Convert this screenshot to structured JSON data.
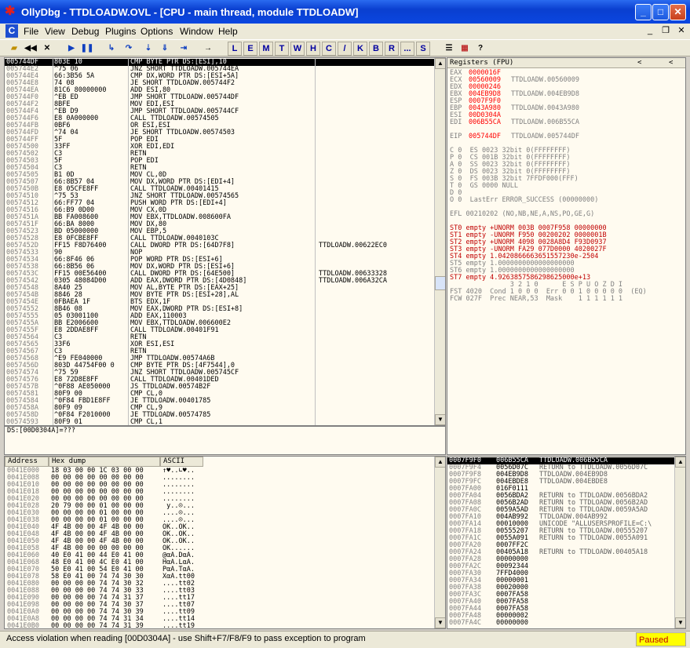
{
  "window": {
    "title": "OllyDbg - TTDLOADW.OVL - [CPU - main thread, module TTDLOADW]",
    "min": "_",
    "max": "□",
    "close": "✕"
  },
  "menu": [
    "File",
    "View",
    "Debug",
    "Plugins",
    "Options",
    "Window",
    "Help"
  ],
  "toolbar_letters": [
    "L",
    "E",
    "M",
    "T",
    "W",
    "H",
    "C",
    "/",
    "K",
    "B",
    "R",
    "...",
    "S"
  ],
  "disasm": [
    [
      "005744DF",
      "803E 10",
      "CMP BYTE PTR DS:[ESI],10",
      ""
    ],
    [
      "005744E2",
      "^75 06",
      "JNZ SHORT TTDLOADW.005744EA",
      ""
    ],
    [
      "005744E4",
      "66:3B56 5A",
      "CMP DX,WORD PTR DS:[ESI+5A]",
      ""
    ],
    [
      "005744E8",
      "74 08",
      "JE SHORT TTDLOADW.005744F2",
      ""
    ],
    [
      "005744EA",
      "81C6 80000000",
      "ADD ESI,80",
      ""
    ],
    [
      "005744F0",
      "^EB ED",
      "JMP SHORT TTDLOADW.005744DF",
      ""
    ],
    [
      "005744F2",
      "8BFE",
      "MOV EDI,ESI",
      ""
    ],
    [
      "005744F4",
      "^EB D9",
      "JMP SHORT TTDLOADW.005744CF",
      ""
    ],
    [
      "005744F6",
      "E8 0A000000",
      "CALL TTDLOADW.00574505",
      ""
    ],
    [
      "005744FB",
      "0BF6",
      "OR ESI,ESI",
      ""
    ],
    [
      "005744FD",
      "^74 04",
      "JE SHORT TTDLOADW.00574503",
      ""
    ],
    [
      "005744FF",
      "5F",
      "POP EDI",
      ""
    ],
    [
      "00574500",
      "33FF",
      "XOR EDI,EDI",
      ""
    ],
    [
      "00574502",
      "C3",
      "RETN",
      ""
    ],
    [
      "00574503",
      "5F",
      "POP EDI",
      ""
    ],
    [
      "00574504",
      "C3",
      "RETN",
      ""
    ],
    [
      "00574505",
      "B1 0D",
      "MOV CL,0D",
      ""
    ],
    [
      "00574507",
      "66:8B57 04",
      "MOV DX,WORD PTR DS:[EDI+4]",
      ""
    ],
    [
      "0057450B",
      "E8 05CFE8FF",
      "CALL TTDLOADW.00401415",
      ""
    ],
    [
      "00574510",
      "^75 53",
      "JNZ SHORT TTDLOADW.00574565",
      ""
    ],
    [
      "00574512",
      "66:FF77 04",
      "PUSH WORD PTR DS:[EDI+4]",
      ""
    ],
    [
      "00574516",
      "66:B9 0D00",
      "MOV CX,0D",
      ""
    ],
    [
      "0057451A",
      "BB FA008600",
      "MOV EBX,TTDLOADW.008600FA",
      ""
    ],
    [
      "0057451F",
      "66:BA 8000",
      "MOV DX,80",
      ""
    ],
    [
      "00574523",
      "BD 05000000",
      "MOV EBP,5",
      ""
    ],
    [
      "00574528",
      "E8 0FCBE8FF",
      "CALL TTDLOADW.0040103C",
      ""
    ],
    [
      "0057452D",
      "FF15 F8D76400",
      "CALL DWORD PTR DS:[64D7F8]",
      "TTDLOADW.00622EC0"
    ],
    [
      "00574533",
      "90",
      "NOP",
      ""
    ],
    [
      "00574534",
      "66:8F46 06",
      "POP WORD PTR DS:[ESI+6]",
      ""
    ],
    [
      "00574538",
      "66:8B56 06",
      "MOV DX,WORD PTR DS:[ESI+6]",
      ""
    ],
    [
      "0057453C",
      "FF15 00E56400",
      "CALL DWORD PTR DS:[64E500]",
      "TTDLOADW.00633328"
    ],
    [
      "00574542",
      "0305 48084D00",
      "ADD EAX,DWORD PTR DS:[4D0848]",
      "TTDLOADW.006A32CA"
    ],
    [
      "00574548",
      "8A40 25",
      "MOV AL,BYTE PTR DS:[EAX+25]",
      ""
    ],
    [
      "0057454B",
      "8846 28",
      "MOV BYTE PTR DS:[ESI+28],AL",
      ""
    ],
    [
      "0057454E",
      "0FBAEA 1F",
      "BTS EDX,1F",
      ""
    ],
    [
      "00574552",
      "8B46 08",
      "MOV EAX,DWORD PTR DS:[ESI+8]",
      ""
    ],
    [
      "00574555",
      "05 03001100",
      "ADD EAX,110003",
      ""
    ],
    [
      "0057455A",
      "BB E2006600",
      "MOV EBX,TTDLOADW.006600E2",
      ""
    ],
    [
      "0057455F",
      "E8 2DDAE8FF",
      "CALL TTDLOADW.00401F91",
      ""
    ],
    [
      "00574564",
      "C3",
      "RETN",
      ""
    ],
    [
      "00574565",
      "33F6",
      "XOR ESI,ESI",
      ""
    ],
    [
      "00574567",
      "C3",
      "RETN",
      ""
    ],
    [
      "00574568",
      "^E9 FE040000",
      "JMP TTDLOADW.00574A6B",
      ""
    ],
    [
      "0057456D",
      "803D 44754F00 0",
      "CMP BYTE PTR DS:[4F7544],0",
      ""
    ],
    [
      "00574574",
      "^75 59",
      "JNZ SHORT TTDLOADW.005745CF",
      ""
    ],
    [
      "00574576",
      "E8 72D8E8FF",
      "CALL TTDLOADW.00401DED",
      ""
    ],
    [
      "0057457B",
      "^0F88 AE050000",
      "JS TTDLOADW.00574B2F",
      ""
    ],
    [
      "00574581",
      "80F9 00",
      "CMP CL,0",
      ""
    ],
    [
      "00574584",
      "^0F84 FBD1E8FF",
      "JE TTDLOADW.00401785",
      ""
    ],
    [
      "0057458A",
      "80F9 09",
      "CMP CL,9",
      ""
    ],
    [
      "0057458D",
      "^0F84 F2010000",
      "JE TTDLOADW.00574785",
      ""
    ],
    [
      "00574593",
      "80F9 01",
      "CMP CL,1",
      ""
    ]
  ],
  "info_line": "DS:[00D0304A]=???",
  "registers": {
    "header": "Registers (FPU)",
    "lines": [
      [
        "EAX",
        "0000016F",
        ""
      ],
      [
        "ECX",
        "00560009",
        "TTDLOADW.00560009"
      ],
      [
        "EDX",
        "00000246",
        ""
      ],
      [
        "EBX",
        "004EB9D8",
        "TTDLOADW.004EB9D8"
      ],
      [
        "ESP",
        "0007F9F0",
        ""
      ],
      [
        "EBP",
        "0043A980",
        "TTDLOADW.0043A980"
      ],
      [
        "ESI",
        "00D0304A",
        ""
      ],
      [
        "EDI",
        "006B55CA",
        "TTDLOADW.006B55CA"
      ],
      [
        "",
        "",
        " "
      ],
      [
        "EIP",
        "005744DF",
        "TTDLOADW.005744DF"
      ]
    ],
    "flags": [
      "C 0  ES 0023 32bit 0(FFFFFFFF)",
      "P 0  CS 001B 32bit 0(FFFFFFFF)",
      "A 0  SS 0023 32bit 0(FFFFFFFF)",
      "Z 0  DS 0023 32bit 0(FFFFFFFF)",
      "S 0  FS 003B 32bit 7FFDF000(FFF)",
      "T 0  GS 0000 NULL",
      "D 0",
      "O 0  LastErr ERROR_SUCCESS (00000000)"
    ],
    "efl": "EFL 00210202 (NO,NB,NE,A,NS,PO,GE,G)",
    "fpu": [
      "ST0 empty +UNORM 003B 0007F958 00000000",
      "ST1 empty -UNORM F950 00200202 0000001B",
      "ST2 empty +UNORM 4098 0028A8D4 F93D0937",
      "ST3 empty -UNORM FA29 077D0000 4020027F",
      "ST4 empty 1.0420866663651557230e-2504",
      "ST5 empty 1.0000000000000000000",
      "ST6 empty 1.0000000000000000000",
      "ST7 empty 4.9263857586298625000e+13"
    ],
    "fst_head": "               3 2 1 0      E S P U O Z D I",
    "fst": "FST 4020  Cond 1 0 0 0  Err 0 0 1 0 0 0 0 0  (EQ)",
    "fcw": "FCW 027F  Prec NEAR,53  Mask    1 1 1 1 1 1"
  },
  "dump": {
    "headers": [
      "Address",
      "Hex dump",
      "ASCII"
    ],
    "rows": [
      [
        "0041E000",
        "18 03 00 00 1C 03 00 00",
        "↑♥..∟♥.."
      ],
      [
        "0041E008",
        "00 00 00 00 00 00 00 00",
        "........"
      ],
      [
        "0041E010",
        "00 00 00 00 00 00 00 00",
        "........"
      ],
      [
        "0041E018",
        "00 00 00 00 00 00 00 00",
        "........"
      ],
      [
        "0041E020",
        "00 00 00 00 00 00 00 00",
        "........"
      ],
      [
        "0041E028",
        "20 79 00 00 01 00 00 00",
        " y..☺..."
      ],
      [
        "0041E030",
        "00 00 00 00 01 00 00 00",
        "....☺..."
      ],
      [
        "0041E038",
        "00 00 00 00 01 00 00 00",
        "....☺..."
      ],
      [
        "0041E040",
        "4F 4B 00 00 4F 4B 00 00",
        "OK..OK.."
      ],
      [
        "0041E048",
        "4F 4B 00 00 4F 4B 00 00",
        "OK..OK.."
      ],
      [
        "0041E050",
        "4F 4B 00 00 4F 4B 00 00",
        "OK..OK.."
      ],
      [
        "0041E058",
        "4F 4B 00 00 00 00 00 00",
        "OK......"
      ],
      [
        "0041E060",
        "40 E0 41 00 44 E0 41 00",
        "@αA.DαA."
      ],
      [
        "0041E068",
        "48 E0 41 00 4C E0 41 00",
        "HαA.LαA."
      ],
      [
        "0041E070",
        "50 E0 41 00 54 E0 41 00",
        "PαA.TαA."
      ],
      [
        "0041E078",
        "58 E0 41 00 74 74 30 30",
        "XαA.tt00"
      ],
      [
        "0041E080",
        "00 00 00 00 74 74 30 32",
        "....tt02"
      ],
      [
        "0041E088",
        "00 00 00 00 74 74 30 33",
        "....tt03"
      ],
      [
        "0041E090",
        "00 00 00 00 74 74 31 37",
        "....tt17"
      ],
      [
        "0041E098",
        "00 00 00 00 74 74 30 37",
        "....tt07"
      ],
      [
        "0041E0A0",
        "00 00 00 00 74 74 30 39",
        "....tt09"
      ],
      [
        "0041E0A8",
        "00 00 00 00 74 74 31 34",
        "....tt14"
      ],
      [
        "0041E0B0",
        "00 00 00 00 74 74 31 39",
        "....tt19"
      ]
    ]
  },
  "stack": [
    [
      "0007F9F0",
      "006B55CA",
      "TTDLOADW.006B55CA"
    ],
    [
      "0007F9F4",
      "0056D07C",
      "RETURN to TTDLOADW.0056D07C"
    ],
    [
      "0007F9F8",
      "004EB9D8",
      "TTDLOADW.004EB9D8"
    ],
    [
      "0007F9FC",
      "004EBDE8",
      "TTDLOADW.004EBDE8"
    ],
    [
      "0007FA00",
      "016F0111",
      ""
    ],
    [
      "0007FA04",
      "0056BDA2",
      "RETURN to TTDLOADW.0056BDA2"
    ],
    [
      "0007FA08",
      "0056B2AD",
      "RETURN to TTDLOADW.0056B2AD"
    ],
    [
      "0007FA0C",
      "0059A5AD",
      "RETURN to TTDLOADW.0059A5AD"
    ],
    [
      "0007FA10",
      "004AB992",
      "TTDLOADW.004AB992"
    ],
    [
      "0007FA14",
      "00010000",
      "UNICODE \"ALLUSERSPROFILE=C:\\"
    ],
    [
      "0007FA18",
      "00555207",
      "RETURN to TTDLOADW.00555207"
    ],
    [
      "0007FA1C",
      "0055A091",
      "RETURN to TTDLOADW.0055A091"
    ],
    [
      "0007FA20",
      "0007FF2C",
      ""
    ],
    [
      "0007FA24",
      "00405A18",
      "RETURN to TTDLOADW.00405A18"
    ],
    [
      "0007FA28",
      "00000000",
      ""
    ],
    [
      "0007FA2C",
      "00092344",
      ""
    ],
    [
      "0007FA30",
      "7FFD4000",
      ""
    ],
    [
      "0007FA34",
      "00000001",
      ""
    ],
    [
      "0007FA38",
      "00020000",
      ""
    ],
    [
      "0007FA3C",
      "0007FA58",
      ""
    ],
    [
      "0007FA40",
      "0007FA58",
      ""
    ],
    [
      "0007FA44",
      "0007FA58",
      ""
    ],
    [
      "0007FA48",
      "00000002",
      ""
    ],
    [
      "0007FA4C",
      "00000000",
      ""
    ]
  ],
  "status": {
    "message": "Access violation when reading [00D0304A] - use Shift+F7/F8/F9 to pass exception to program",
    "state": "Paused"
  }
}
